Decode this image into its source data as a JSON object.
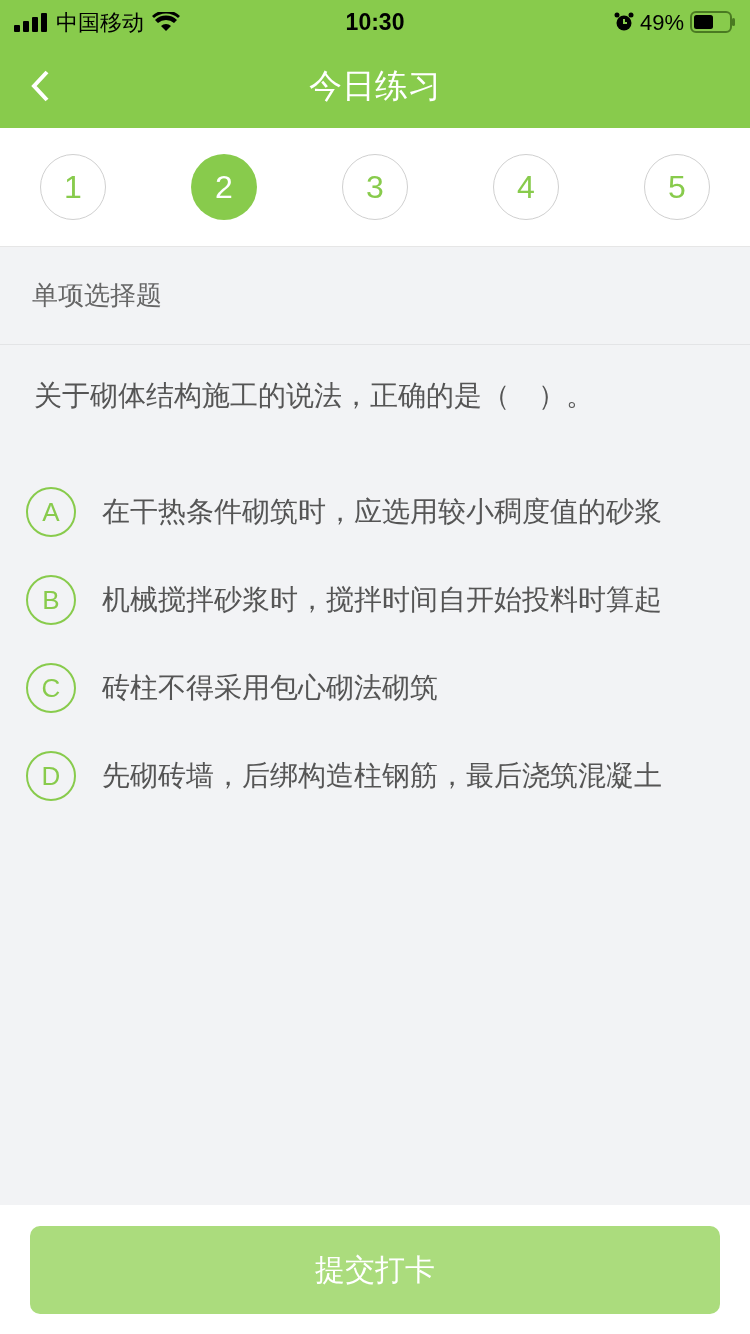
{
  "status_bar": {
    "carrier": "中国移动",
    "time": "10:30",
    "battery": "49%"
  },
  "nav": {
    "title": "今日练习"
  },
  "steps": [
    {
      "label": "1",
      "selected": false
    },
    {
      "label": "2",
      "selected": true
    },
    {
      "label": "3",
      "selected": false
    },
    {
      "label": "4",
      "selected": false
    },
    {
      "label": "5",
      "selected": false
    }
  ],
  "section": {
    "title": "单项选择题"
  },
  "question": {
    "text": "关于砌体结构施工的说法，正确的是（　）。"
  },
  "options": [
    {
      "letter": "A",
      "text": "在干热条件砌筑时，应选用较小稠度值的砂浆",
      "selected": false
    },
    {
      "letter": "B",
      "text": "机械搅拌砂浆时，搅拌时间自开始投料时算起",
      "selected": false
    },
    {
      "letter": "C",
      "text": "砖柱不得采用包心砌法砌筑",
      "selected": false
    },
    {
      "letter": "D",
      "text": "先砌砖墙，后绑构造柱钢筋，最后浇筑混凝土",
      "selected": false
    }
  ],
  "submit": {
    "label": "提交打卡",
    "disabled": true
  }
}
